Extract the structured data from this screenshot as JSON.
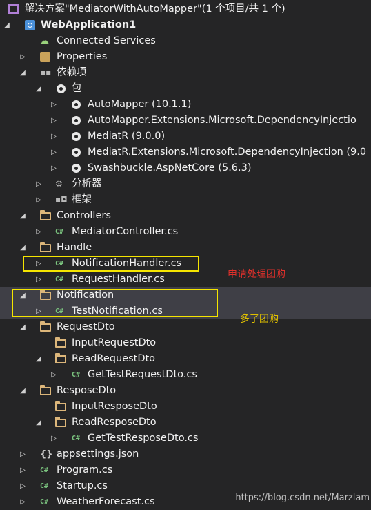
{
  "solution": {
    "title": "解决方案\"MediatorWithAutoMapper\"(1 个项目/共 1 个)"
  },
  "project": {
    "name": "WebApplication1"
  },
  "tree": {
    "connected": "Connected Services",
    "properties": "Properties",
    "dependencies": "依赖项",
    "packages": "包",
    "pkg1": "AutoMapper (10.1.1)",
    "pkg2": "AutoMapper.Extensions.Microsoft.DependencyInjectio",
    "pkg3": "MediatR (9.0.0)",
    "pkg4": "MediatR.Extensions.Microsoft.DependencyInjection (9.0",
    "pkg5": "Swashbuckle.AspNetCore (5.6.3)",
    "analyzers": "分析器",
    "frameworks": "框架",
    "controllers": "Controllers",
    "mediator_controller": "MediatorController.cs",
    "handle": "Handle",
    "notification_handler": "NotificationHandler.cs",
    "request_handler": "RequestHandler.cs",
    "notification": "Notification",
    "test_notification": "TestNotification.cs",
    "request_dto": "RequestDto",
    "input_request_dto": "InputRequestDto",
    "read_request_dto": "ReadRequestDto",
    "get_test_request_dto": "GetTestRequestDto.cs",
    "respose_dto": "ResposeDto",
    "input_respose_dto": "InputResposeDto",
    "read_respose_dto": "ReadResposeDto",
    "get_test_respose_dto": "GetTestResposeDto.cs",
    "appsettings": "appsettings.json",
    "program": "Program.cs",
    "startup": "Startup.cs",
    "weather": "WeatherForecast.cs"
  },
  "icons": {
    "cs": "C#"
  },
  "annotations": {
    "note1": "申请处理团购",
    "note2": "多了团购"
  },
  "watermark": "https://blog.csdn.net/Marzlam",
  "colors": {
    "highlight_box": "#f5e500",
    "note1": "#e0302b",
    "note2": "#e0c000",
    "folder": "#dcb67a",
    "cs": "#7bc47f"
  }
}
